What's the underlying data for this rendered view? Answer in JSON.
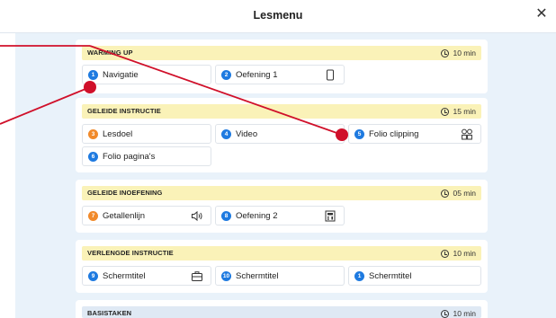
{
  "header": {
    "title": "Lesmenu",
    "close_symbol": "✕"
  },
  "colors": {
    "accent_blue": "#1e7ae0",
    "accent_orange": "#f18a2b",
    "header_yellow": "#faf2b8",
    "background": "#e9f2fa",
    "annotation_red": "#d0102a"
  },
  "sections": [
    {
      "title": "WARMING UP",
      "time": "10 min",
      "items": [
        {
          "num": "1",
          "label": "Navigatie",
          "color": "blue",
          "icon": ""
        },
        {
          "num": "2",
          "label": "Oefening 1",
          "color": "blue",
          "icon": "tablet-icon"
        }
      ]
    },
    {
      "title": "GELEIDE INSTRUCTIE",
      "time": "15 min",
      "items": [
        {
          "num": "3",
          "label": "Lesdoel",
          "color": "orange",
          "icon": ""
        },
        {
          "num": "4",
          "label": "Video",
          "color": "blue",
          "icon": ""
        },
        {
          "num": "5",
          "label": "Folio clipping",
          "color": "blue",
          "icon": "grid-icon"
        },
        {
          "num": "6",
          "label": "Folio pagina's",
          "color": "blue",
          "icon": ""
        }
      ]
    },
    {
      "title": "GELEIDE INOEFENING",
      "time": "05 min",
      "items": [
        {
          "num": "7",
          "label": "Getallenlijn",
          "color": "orange",
          "icon": "speaker-icon"
        },
        {
          "num": "8",
          "label": "Oefening 2",
          "color": "blue",
          "icon": "calculator-icon"
        }
      ]
    },
    {
      "title": "VERLENGDE INSTRUCTIE",
      "time": "10 min",
      "items": [
        {
          "num": "9",
          "label": "Schermtitel",
          "color": "blue",
          "icon": "briefcase-icon"
        },
        {
          "num": "10",
          "label": "Schermtitel",
          "color": "blue",
          "icon": ""
        },
        {
          "num": "1",
          "label": "Schermtitel",
          "color": "blue",
          "icon": ""
        }
      ]
    },
    {
      "title": "BASISTAKEN",
      "time": "10 min",
      "items": []
    }
  ]
}
